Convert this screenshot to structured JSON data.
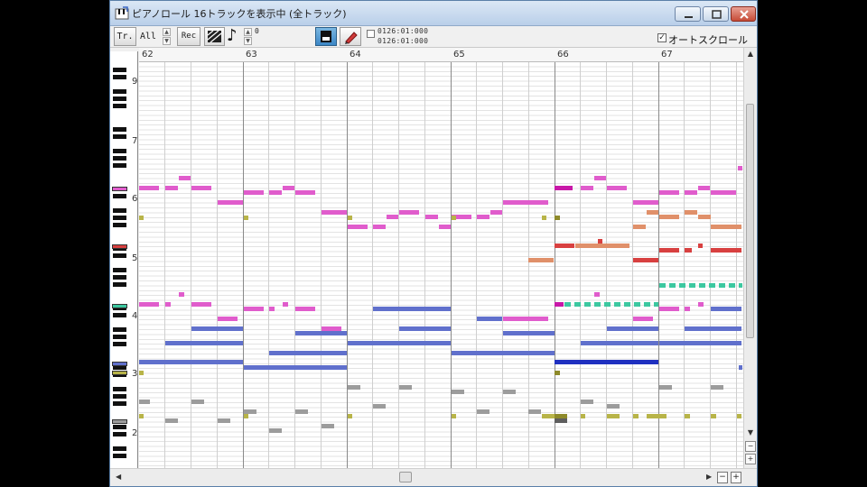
{
  "window": {
    "title": "ピアノロール 16トラックを表示中 (全トラック)"
  },
  "toolbar": {
    "track_button_label": "Tr.",
    "track_select_value": "All",
    "record_button_label": "Rec",
    "octave_value": "0",
    "position_readout_1": "0126:01:000",
    "position_readout_2": "0126:01:000",
    "autoscroll_label": "オートスクロール",
    "autoscroll_checked": true
  },
  "ruler": {
    "measures": [
      "62",
      "63",
      "64",
      "65",
      "66",
      "67"
    ]
  },
  "keyboard": {
    "octave_labels": [
      "9",
      "7",
      "6",
      "5",
      "4",
      "3",
      "2"
    ]
  },
  "colors": {
    "pink": "#e05ccc",
    "blue": "#6070cc",
    "dark_blue": "#1f30c0",
    "salmon": "#e0906a",
    "red": "#d84040",
    "teal": "#3cc8a0",
    "gray": "#9c9c9c",
    "olive": "#b8b448",
    "magenta": "#c818a8"
  }
}
